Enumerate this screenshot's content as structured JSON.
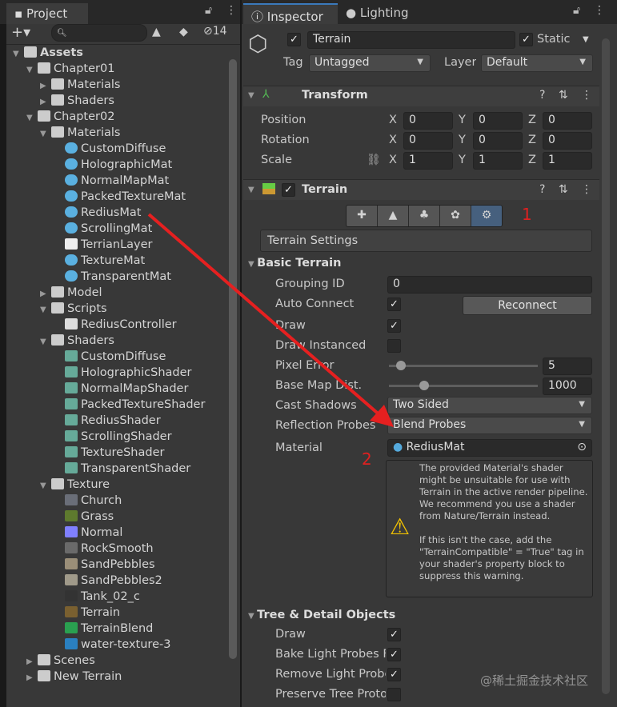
{
  "project": {
    "tab": "Project",
    "badge": "14",
    "add": "+▾",
    "tree": [
      {
        "d": 0,
        "t": "folder",
        "label": "Assets",
        "exp": true,
        "bold": true
      },
      {
        "d": 1,
        "t": "folder",
        "label": "Chapter01",
        "exp": true
      },
      {
        "d": 2,
        "t": "folder",
        "label": "Materials",
        "exp": false
      },
      {
        "d": 2,
        "t": "folder",
        "label": "Shaders",
        "exp": false
      },
      {
        "d": 1,
        "t": "folder",
        "label": "Chapter02",
        "exp": true
      },
      {
        "d": 2,
        "t": "folder",
        "label": "Materials",
        "exp": true
      },
      {
        "d": 3,
        "t": "mat",
        "label": "CustomDiffuse"
      },
      {
        "d": 3,
        "t": "mat",
        "label": "HolographicMat"
      },
      {
        "d": 3,
        "t": "mat",
        "label": "NormalMapMat"
      },
      {
        "d": 3,
        "t": "mat",
        "label": "PackedTextureMat"
      },
      {
        "d": 3,
        "t": "mat",
        "label": "RediusMat"
      },
      {
        "d": 3,
        "t": "mat",
        "label": "ScrollingMat"
      },
      {
        "d": 3,
        "t": "file",
        "label": "TerrianLayer"
      },
      {
        "d": 3,
        "t": "mat",
        "label": "TextureMat"
      },
      {
        "d": 3,
        "t": "mat",
        "label": "TransparentMat"
      },
      {
        "d": 2,
        "t": "folder",
        "label": "Model",
        "exp": false
      },
      {
        "d": 2,
        "t": "folder",
        "label": "Scripts",
        "exp": true
      },
      {
        "d": 3,
        "t": "script",
        "label": "RediusController"
      },
      {
        "d": 2,
        "t": "folder",
        "label": "Shaders",
        "exp": true
      },
      {
        "d": 3,
        "t": "shader",
        "label": "CustomDiffuse"
      },
      {
        "d": 3,
        "t": "shader",
        "label": "HolographicShader"
      },
      {
        "d": 3,
        "t": "shader",
        "label": "NormalMapShader"
      },
      {
        "d": 3,
        "t": "shader",
        "label": "PackedTextureShader"
      },
      {
        "d": 3,
        "t": "shader",
        "label": "RediusShader"
      },
      {
        "d": 3,
        "t": "shader",
        "label": "ScrollingShader"
      },
      {
        "d": 3,
        "t": "shader",
        "label": "TextureShader"
      },
      {
        "d": 3,
        "t": "shader",
        "label": "TransparentShader"
      },
      {
        "d": 2,
        "t": "folder",
        "label": "Texture",
        "exp": true
      },
      {
        "d": 3,
        "t": "tex",
        "label": "Church",
        "c": "#6a6e78"
      },
      {
        "d": 3,
        "t": "tex",
        "label": "Grass",
        "c": "#5e7a2e"
      },
      {
        "d": 3,
        "t": "tex",
        "label": "Normal",
        "c": "#8080ff"
      },
      {
        "d": 3,
        "t": "tex",
        "label": "RockSmooth",
        "c": "#6a6a6a"
      },
      {
        "d": 3,
        "t": "tex",
        "label": "SandPebbles",
        "c": "#9a8e78"
      },
      {
        "d": 3,
        "t": "tex",
        "label": "SandPebbles2",
        "c": "#a09a8a"
      },
      {
        "d": 3,
        "t": "tex",
        "label": "Tank_02_c",
        "c": "#333"
      },
      {
        "d": 3,
        "t": "tex",
        "label": "Terrain",
        "c": "#7a6030"
      },
      {
        "d": 3,
        "t": "tex",
        "label": "TerrainBlend",
        "c": "#2aa050"
      },
      {
        "d": 3,
        "t": "tex",
        "label": "water-texture-3",
        "c": "#2a80c0"
      },
      {
        "d": 1,
        "t": "folder",
        "label": "Scenes",
        "exp": false
      },
      {
        "d": 1,
        "t": "scene",
        "label": "New Terrain",
        "exp": false
      }
    ]
  },
  "inspector": {
    "tabs": [
      "Inspector",
      "Lighting"
    ],
    "name": "Terrain",
    "static": "Static",
    "tag_label": "Tag",
    "tag": "Untagged",
    "layer_label": "Layer",
    "layer": "Default",
    "transform": {
      "title": "Transform",
      "rows": [
        {
          "label": "Position",
          "x": "0",
          "y": "0",
          "z": "0"
        },
        {
          "label": "Rotation",
          "x": "0",
          "y": "0",
          "z": "0"
        },
        {
          "label": "Scale",
          "x": "1",
          "y": "1",
          "z": "1"
        }
      ],
      "axes": [
        "X",
        "Y",
        "Z"
      ]
    },
    "terrain": {
      "title": "Terrain",
      "settings_btn": "Terrain Settings",
      "basic": "Basic Terrain",
      "grouping_label": "Grouping ID",
      "grouping": "0",
      "auto_label": "Auto Connect",
      "reconnect": "Reconnect",
      "draw_label": "Draw",
      "instanced_label": "Draw Instanced",
      "pixel_label": "Pixel Error",
      "pixel": "5",
      "pixel_frac": 0.05,
      "basemap_label": "Base Map Dist.",
      "basemap": "1000",
      "basemap_frac": 0.22,
      "shadows_label": "Cast Shadows",
      "shadows": "Two Sided",
      "probes_label": "Reflection Probes",
      "probes": "Blend Probes",
      "material_label": "Material",
      "material": "RediusMat",
      "warning": "The provided Material's shader might be unsuitable for use with Terrain in the active render pipeline. We recommend you use a shader from Nature/Terrain instead.",
      "warning2": "If this isn't the case, add the \"TerrainCompatible\" = \"True\" tag in your shader's property block to suppress this warning.",
      "tree_title": "Tree & Detail Objects",
      "tree_draw": "Draw",
      "bake": "Bake Light Probes For Trees",
      "remove": "Remove Light Probe Ringing",
      "preserve": "Preserve Tree Prototype Layers"
    }
  },
  "annotations": {
    "one": "1",
    "two": "2",
    "watermark": "@稀土掘金技术社区"
  }
}
